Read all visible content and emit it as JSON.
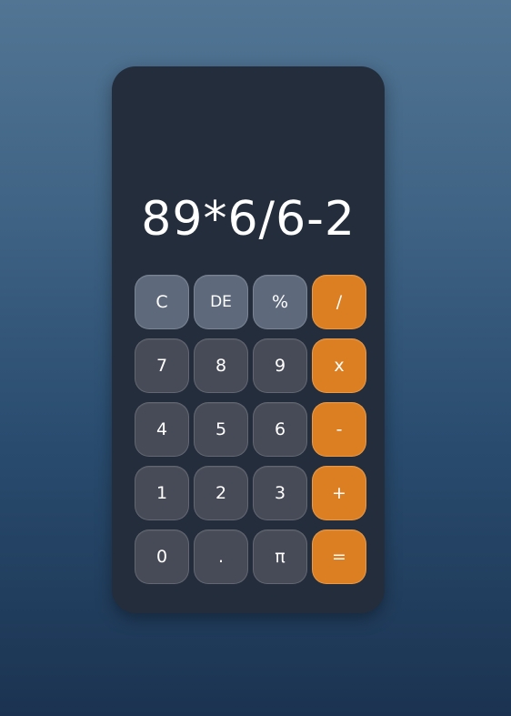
{
  "display": {
    "expression": "89*6/6-2"
  },
  "keypad": {
    "keys": [
      {
        "label": "C",
        "name": "clear-button",
        "kind": "func"
      },
      {
        "label": "DE",
        "name": "delete-button",
        "kind": "func"
      },
      {
        "label": "%",
        "name": "percent-button",
        "kind": "func"
      },
      {
        "label": "/",
        "name": "divide-button",
        "kind": "op"
      },
      {
        "label": "7",
        "name": "digit-7-button",
        "kind": "num"
      },
      {
        "label": "8",
        "name": "digit-8-button",
        "kind": "num"
      },
      {
        "label": "9",
        "name": "digit-9-button",
        "kind": "num"
      },
      {
        "label": "x",
        "name": "multiply-button",
        "kind": "op"
      },
      {
        "label": "4",
        "name": "digit-4-button",
        "kind": "num"
      },
      {
        "label": "5",
        "name": "digit-5-button",
        "kind": "num"
      },
      {
        "label": "6",
        "name": "digit-6-button",
        "kind": "num"
      },
      {
        "label": "-",
        "name": "subtract-button",
        "kind": "op"
      },
      {
        "label": "1",
        "name": "digit-1-button",
        "kind": "num"
      },
      {
        "label": "2",
        "name": "digit-2-button",
        "kind": "num"
      },
      {
        "label": "3",
        "name": "digit-3-button",
        "kind": "num"
      },
      {
        "label": "+",
        "name": "add-button",
        "kind": "op"
      },
      {
        "label": "0",
        "name": "digit-0-button",
        "kind": "num"
      },
      {
        "label": ".",
        "name": "decimal-point-button",
        "kind": "num"
      },
      {
        "label": "π",
        "name": "pi-button",
        "kind": "num"
      },
      {
        "label": "=",
        "name": "equals-button",
        "kind": "op"
      }
    ]
  },
  "colors": {
    "calculator_body": "#232d3b",
    "number_key": "#474b57",
    "function_key": "#5e6a7c",
    "operator_key": "#dc7f22",
    "text": "#ffffff"
  }
}
